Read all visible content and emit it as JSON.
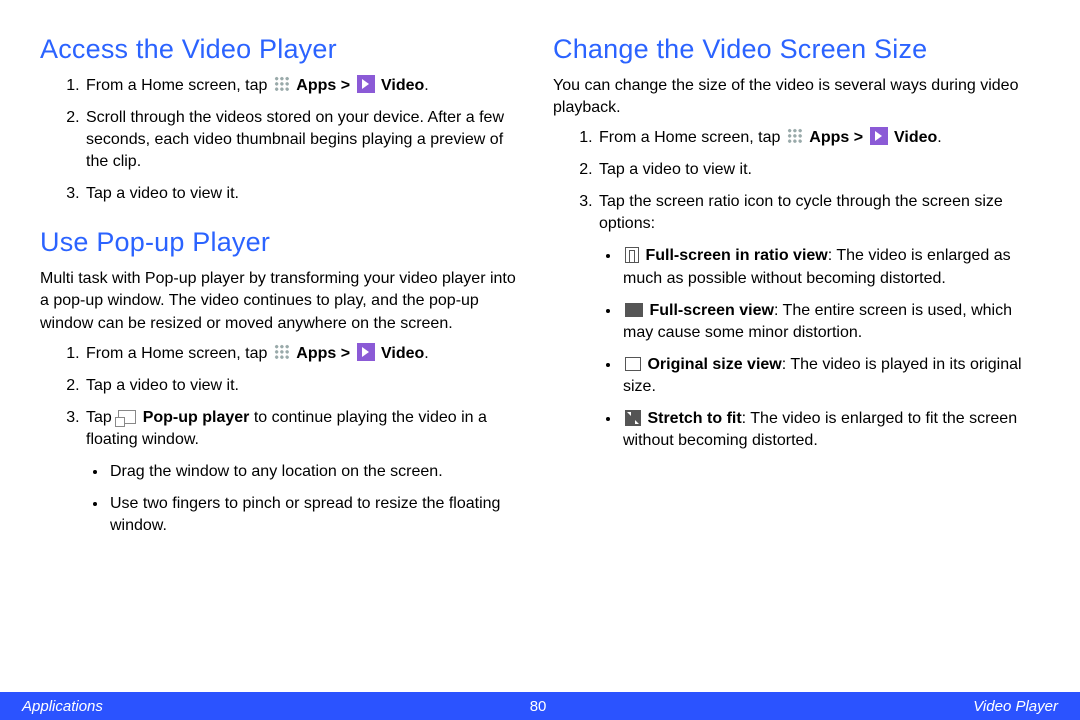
{
  "left": {
    "section1": {
      "heading": "Access the Video Player",
      "step1_a": "From a Home screen, tap ",
      "apps_label": "Apps",
      "gt": ">",
      "video_label": "Video",
      "step1_d": ".",
      "step2": "Scroll through the videos stored on your device. After a few seconds, each video thumbnail begins playing a preview of the clip.",
      "step3": "Tap a video to view it."
    },
    "section2": {
      "heading": "Use Pop-up Player",
      "intro": "Multi task with Pop-up player by transforming your video player into a pop-up window. The video continues to play, and the pop-up window can be resized or moved anywhere on the screen.",
      "step1_a": "From a Home screen, tap ",
      "apps_label": "Apps",
      "gt": ">",
      "video_label": "Video",
      "step1_d": ".",
      "step2": "Tap a video to view it.",
      "step3_a": "Tap ",
      "popup_label": "Pop-up player",
      "step3_b": " to continue playing the video in a floating window.",
      "sub1": "Drag the window to any location on the screen.",
      "sub2": "Use two fingers to pinch or spread to resize the floating window."
    }
  },
  "right": {
    "heading": "Change the Video Screen Size",
    "intro": "You can change the size of the video is several ways during video playback.",
    "step1_a": "From a Home screen, tap ",
    "apps_label": "Apps",
    "gt": ">",
    "video_label": "Video",
    "step1_d": ".",
    "step2": "Tap a video to view it.",
    "step3": "Tap the screen ratio icon to cycle through the screen size options:",
    "opt1_label": "Full-screen in ratio view",
    "opt1_text": ": The video is enlarged as much as possible without becoming distorted.",
    "opt2_label": "Full-screen view",
    "opt2_text": ": The entire screen is used, which may cause some minor distortion.",
    "opt3_label": "Original size view",
    "opt3_text": ": The video is played in its original size.",
    "opt4_label": "Stretch to fit",
    "opt4_text": ": The video is enlarged to fit the screen without becoming distorted."
  },
  "footer": {
    "left": "Applications",
    "center": "80",
    "right": "Video Player"
  }
}
